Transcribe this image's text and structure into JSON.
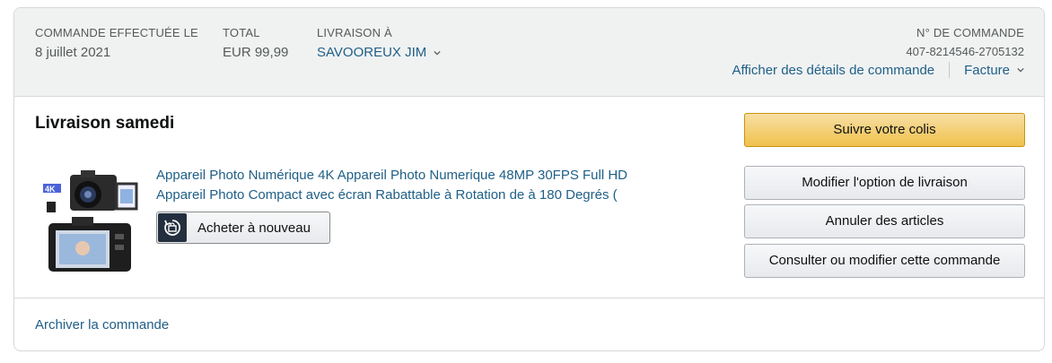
{
  "header": {
    "order_placed_label": "COMMANDE EFFECTUÉE LE",
    "order_placed_value": "8 juillet 2021",
    "total_label": "TOTAL",
    "total_value": "EUR 99,99",
    "ship_to_label": "LIVRAISON À",
    "ship_to_value": "SAVOOREUX JIM",
    "order_number_label": "N° DE COMMANDE",
    "order_number_value": "407-8214546-2705132",
    "order_details_link": "Afficher des détails de commande",
    "invoice_link": "Facture"
  },
  "shipment": {
    "title": "Livraison samedi",
    "product_title_line1": "Appareil Photo Numérique 4K Appareil Photo Numerique 48MP 30FPS Full HD",
    "product_title_line2": "Appareil Photo Compact avec écran Rabattable à Rotation de à 180 Degrés (",
    "buy_again_label": "Acheter à nouveau"
  },
  "actions": {
    "track": "Suivre votre colis",
    "change_delivery": "Modifier l'option de livraison",
    "cancel_items": "Annuler des articles",
    "view_edit_order": "Consulter ou modifier cette commande"
  },
  "footer": {
    "archive_link": "Archiver la commande"
  },
  "colors": {
    "link": "#1f5f86",
    "header_bg": "#f0f2f2",
    "primary_button": "#f0c14b"
  }
}
